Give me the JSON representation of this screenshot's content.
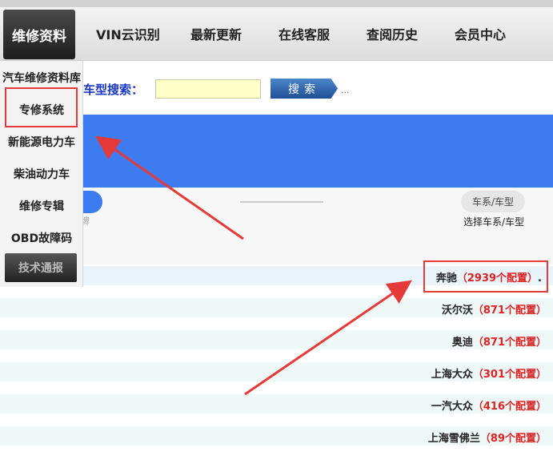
{
  "nav": {
    "active": "维修资料",
    "items": [
      "VIN云识别",
      "最新更新",
      "在线客服",
      "查阅历史",
      "会员中心"
    ]
  },
  "dropdown": {
    "items": [
      "汽车维修资料库",
      "专修系统",
      "新能源电力车",
      "柴油动力车",
      "维修专辑",
      "OBD故障码",
      "技术通报"
    ]
  },
  "search": {
    "label": "车型搜索：",
    "button": "搜索",
    "trail": "..."
  },
  "steps": {
    "left_label": "选择品牌",
    "right_pill": "车系/车型",
    "right_label": "选择车系/车型"
  },
  "brands": [
    {
      "name": "奔驰",
      "count": "（2939个配置）",
      "suffix": "."
    },
    {
      "name": "沃尔沃",
      "count": "（871个配置）",
      "suffix": ""
    },
    {
      "name": "奥迪",
      "count": "（871个配置）",
      "suffix": ""
    },
    {
      "name": "上海大众",
      "count": "（301个配置）",
      "suffix": ""
    },
    {
      "name": "一汽大众",
      "count": "（416个配置）",
      "suffix": ""
    },
    {
      "name": "上海雪佛兰",
      "count": "（89个配置）",
      "suffix": ""
    }
  ],
  "colors": {
    "annotation": "#e53a3a",
    "banner": "#3c7cf0",
    "count_red": "#d22222",
    "search_label": "#1a37c4"
  }
}
